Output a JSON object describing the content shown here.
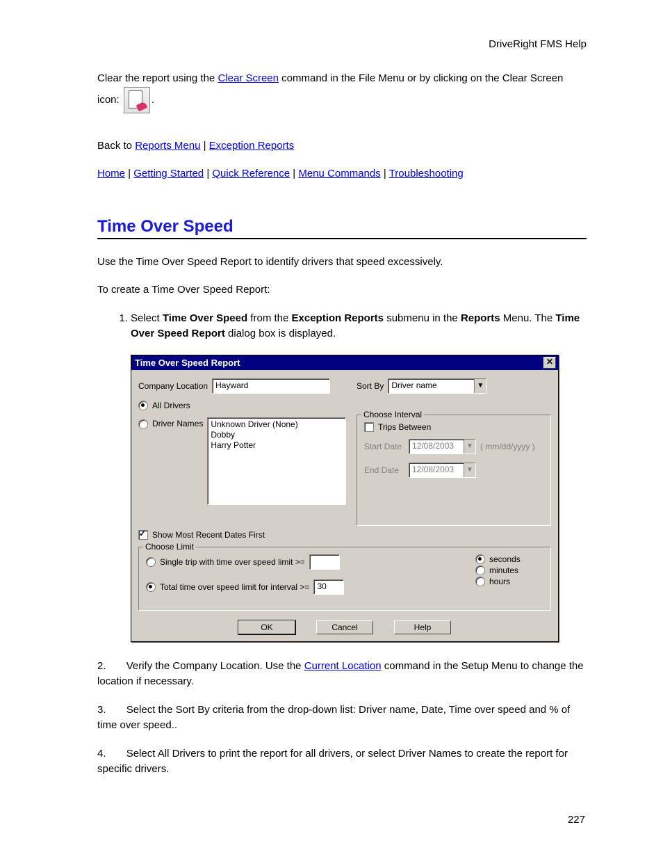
{
  "header": {
    "product": "DriveRight FMS Help"
  },
  "intro": {
    "part1": "Clear the report using the ",
    "link_clear": "Clear Screen",
    "part2": " command in the File Menu or by clicking on the Clear Screen icon: ",
    "period": "."
  },
  "back": {
    "prefix": "Back to ",
    "link_reports": "Reports Menu",
    "sep": " | ",
    "link_exception": "Exception Reports"
  },
  "nav": {
    "home": "Home",
    "getting_started": "Getting Started",
    "quick_ref": "Quick Reference",
    "menu_cmds": "Menu Commands",
    "trouble": "Troubleshooting",
    "sep": " | "
  },
  "section_title": "Time Over Speed",
  "para1": "Use the Time Over Speed Report to identify drivers that speed excessively.",
  "para2": "To create a Time Over Speed Report:",
  "step1": {
    "a": "Select ",
    "b": "Time Over Speed",
    "c": " from the ",
    "d": "Exception Reports",
    "e": " submenu in the ",
    "f": "Reports",
    "g": " Menu. The ",
    "h": "Time Over Speed Report",
    "i": " dialog box is displayed."
  },
  "dialog": {
    "title": "Time Over Speed Report",
    "company_location_label": "Company Location",
    "company_location_value": "Hayward",
    "sort_by_label": "Sort By",
    "sort_by_value": "Driver name",
    "all_drivers": "All Drivers",
    "driver_names": "Driver Names",
    "drivers": [
      "Unknown Driver (None)",
      "Dobby",
      "Harry Potter"
    ],
    "choose_interval": "Choose Interval",
    "trips_between": "Trips Between",
    "start_date_label": "Start Date",
    "start_date_value": "12/08/2003",
    "end_date_label": "End Date",
    "end_date_value": "12/08/2003",
    "date_hint": "( mm/dd/yyyy )",
    "show_recent": "Show Most Recent Dates First",
    "choose_limit": "Choose Limit",
    "single_trip": "Single trip with time over speed limit   >=",
    "total_time": "Total time over speed limit for interval >=",
    "total_time_value": "30",
    "unit_seconds": "seconds",
    "unit_minutes": "minutes",
    "unit_hours": "hours",
    "ok": "OK",
    "cancel": "Cancel",
    "help": "Help"
  },
  "step2": {
    "num": "2.",
    "a": "Verify the Company Location. Use the ",
    "link": "Current Location",
    "b": " command in the Setup Menu to change the location if necessary."
  },
  "step3": {
    "num": "3.",
    "text": "Select the Sort By criteria from the drop-down list: Driver name, Date, Time over speed and % of time over speed.."
  },
  "step4": {
    "num": "4.",
    "text": "Select All Drivers to print the report for all drivers, or select Driver Names to create the report for specific drivers."
  },
  "page_number": "227"
}
